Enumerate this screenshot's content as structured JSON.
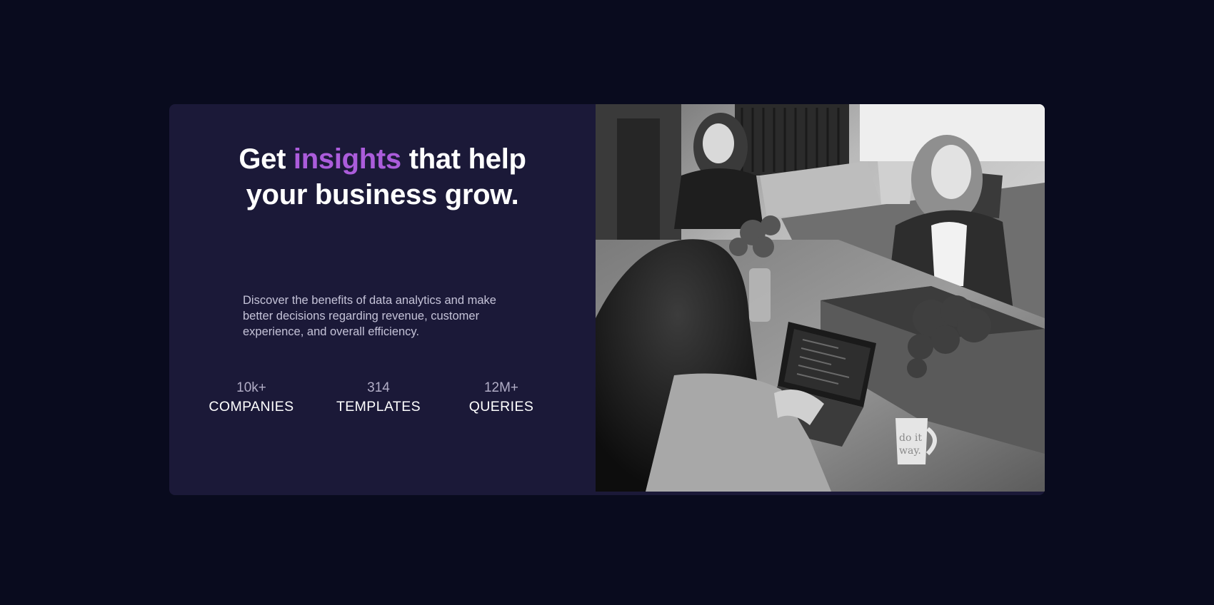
{
  "hero": {
    "headline_before": "Get ",
    "headline_accent": "insights",
    "headline_after": " that help your business grow.",
    "description": "Discover the benefits of data analytics and make better decisions regarding revenue, customer experience, and overall efficiency."
  },
  "stats": [
    {
      "value": "10k+",
      "label": "COMPANIES"
    },
    {
      "value": "314",
      "label": "TEMPLATES"
    },
    {
      "value": "12M+",
      "label": "QUERIES"
    }
  ],
  "image": {
    "description": "Black and white photo of three women working at laptops around a wooden table with plants and a mug",
    "mug_text": [
      "do it",
      "way."
    ]
  },
  "colors": {
    "page_background": "#090b1e",
    "card_background": "#1b1938",
    "accent": "#ab5cdb",
    "text_primary": "#ffffff",
    "text_secondary": "#c5c3d8"
  }
}
